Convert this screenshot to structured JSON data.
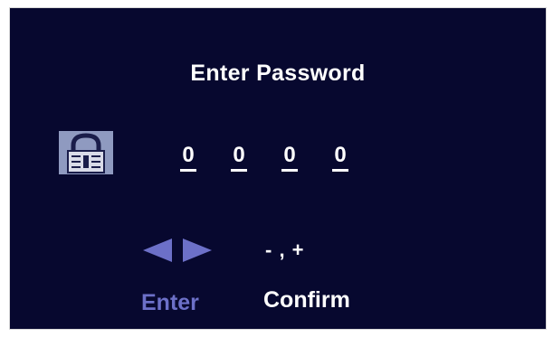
{
  "dialog": {
    "title": "Enter Password"
  },
  "password": {
    "digits": [
      "0",
      "0",
      "0",
      "0"
    ]
  },
  "hints": {
    "navigate_icon": "left-right-arrows-icon",
    "adjust_text": "- , +",
    "enter_label": "Enter",
    "confirm_label": "Confirm"
  },
  "colors": {
    "background": "#07082f",
    "text": "#ffffff",
    "accent": "#6c70c8",
    "lock_icon": "#8f9ac0"
  }
}
